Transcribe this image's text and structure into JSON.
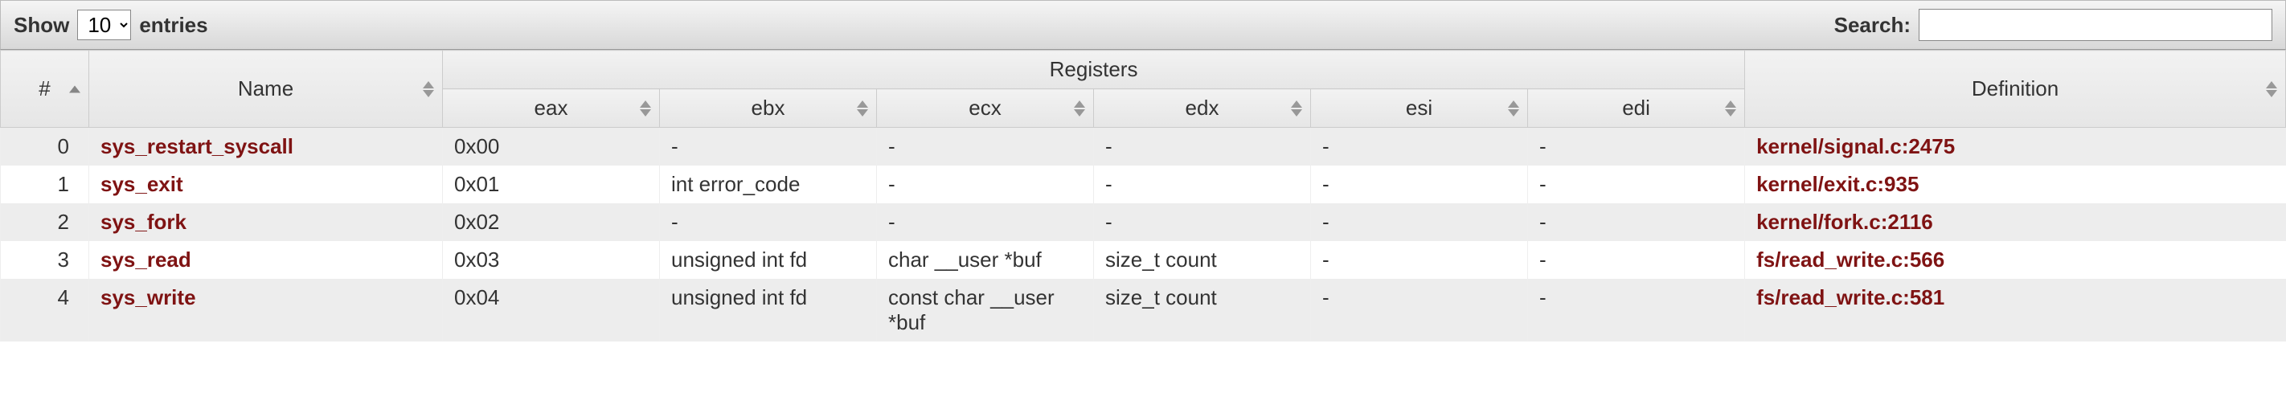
{
  "controls": {
    "show_label_pre": "Show",
    "show_label_post": "entries",
    "entries_value": "10",
    "search_label": "Search:",
    "search_value": ""
  },
  "headers": {
    "num": "#",
    "name": "Name",
    "registers_group": "Registers",
    "registers": [
      "eax",
      "ebx",
      "ecx",
      "edx",
      "esi",
      "edi"
    ],
    "definition": "Definition"
  },
  "rows": [
    {
      "num": "0",
      "name": "sys_restart_syscall",
      "eax": "0x00",
      "ebx": "-",
      "ecx": "-",
      "edx": "-",
      "esi": "-",
      "edi": "-",
      "def": "kernel/signal.c:2475"
    },
    {
      "num": "1",
      "name": "sys_exit",
      "eax": "0x01",
      "ebx": "int error_code",
      "ecx": "-",
      "edx": "-",
      "esi": "-",
      "edi": "-",
      "def": "kernel/exit.c:935"
    },
    {
      "num": "2",
      "name": "sys_fork",
      "eax": "0x02",
      "ebx": "-",
      "ecx": "-",
      "edx": "-",
      "esi": "-",
      "edi": "-",
      "def": "kernel/fork.c:2116"
    },
    {
      "num": "3",
      "name": "sys_read",
      "eax": "0x03",
      "ebx": "unsigned int fd",
      "ecx": "char __user *buf",
      "edx": "size_t count",
      "esi": "-",
      "edi": "-",
      "def": "fs/read_write.c:566"
    },
    {
      "num": "4",
      "name": "sys_write",
      "eax": "0x04",
      "ebx": "unsigned int fd",
      "ecx": "const char __user *buf",
      "edx": "size_t count",
      "esi": "-",
      "edi": "-",
      "def": "fs/read_write.c:581"
    }
  ]
}
